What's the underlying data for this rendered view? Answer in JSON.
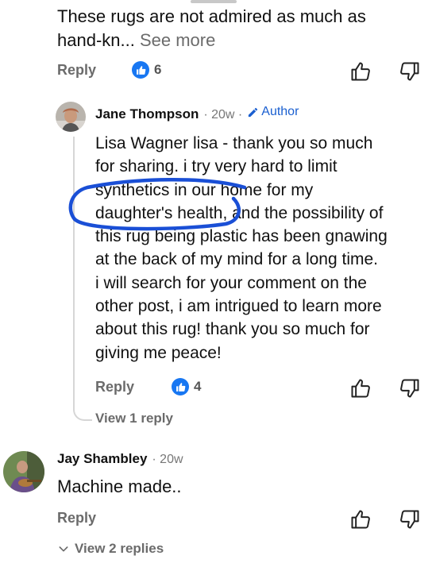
{
  "comment1": {
    "text": "These rugs are not admired as much as hand-kn...",
    "see_more": "See more",
    "reply": "Reply",
    "likes": "6"
  },
  "reply1": {
    "name": "Jane Thompson",
    "time": "· 20w ·",
    "author": "Author",
    "lines": [
      "Lisa Wagner lisa - thank you so much",
      "for sharing. i try very hard to limit",
      "synthetics in our home for my",
      "daughter's health, and the possibility of",
      "this rug being plastic has been gnawing",
      "at the back of my mind for a long time.",
      "i will search for your comment on the",
      "other post, i am intrigued to learn more",
      "about this rug! thank you so much for",
      "giving me peace!"
    ],
    "reply": "Reply",
    "likes": "4",
    "view_replies": "View 1 reply"
  },
  "comment2": {
    "name": "Jay Shambley",
    "time": "· 20w",
    "text": "Machine made..",
    "reply": "Reply",
    "view_replies": "View 2 replies"
  },
  "colors": {
    "like_blue": "#1877f2",
    "author_blue": "#1a5fd0",
    "highlight_ink": "#1a4fd6"
  }
}
